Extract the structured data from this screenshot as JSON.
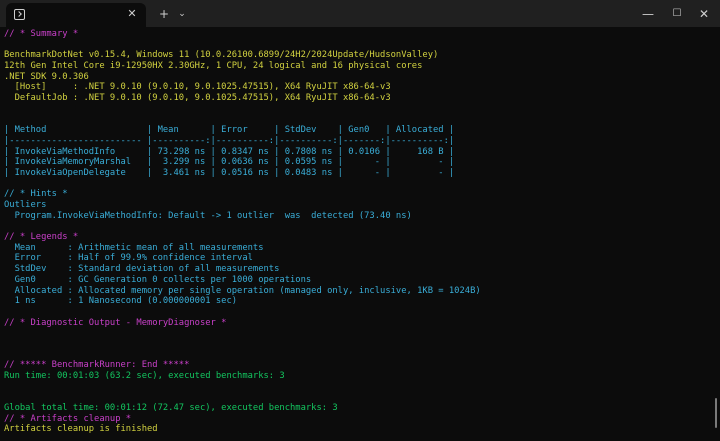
{
  "window": {
    "tab_close": "✕",
    "new_tab": "+",
    "dropdown": "⌄",
    "minimize": "—",
    "maximize": "☐",
    "close": "✕"
  },
  "colors": {
    "background": "#0c0c0c",
    "titlebar": "#202020",
    "magenta": "#c940c9",
    "yellow": "#d2d240",
    "cyan": "#3aaed8",
    "green": "#13c760",
    "white": "#e8e8e8",
    "gray": "#cccccc"
  },
  "terminal": {
    "lines": [
      {
        "text": "// * Summary *",
        "color": "magenta"
      },
      {
        "text": "",
        "color": "gray"
      },
      {
        "text": "BenchmarkDotNet v0.15.4, Windows 11 (10.0.26100.6899/24H2/2024Update/HudsonValley)",
        "color": "yellow"
      },
      {
        "text": "12th Gen Intel Core i9-12950HX 2.30GHz, 1 CPU, 24 logical and 16 physical cores",
        "color": "yellow"
      },
      {
        "text": ".NET SDK 9.0.306",
        "color": "yellow"
      },
      {
        "text": "  [Host]     : .NET 9.0.10 (9.0.10, 9.0.1025.47515), X64 RyuJIT x86-64-v3",
        "color": "yellow"
      },
      {
        "text": "  DefaultJob : .NET 9.0.10 (9.0.10, 9.0.1025.47515), X64 RyuJIT x86-64-v3",
        "color": "yellow"
      },
      {
        "text": "",
        "color": "gray"
      },
      {
        "text": "",
        "color": "gray"
      },
      {
        "text": "| Method                   | Mean      | Error     | StdDev    | Gen0   | Allocated |",
        "color": "cyan"
      },
      {
        "text": "|------------------------- |----------:|----------:|----------:|-------:|----------:|",
        "color": "cyan"
      },
      {
        "text": "| InvokeViaMethodInfo      | 73.298 ns | 0.8347 ns | 0.7808 ns | 0.0106 |     168 B |",
        "color": "cyan"
      },
      {
        "text": "| InvokeViaMemoryMarshal   |  3.299 ns | 0.0636 ns | 0.0595 ns |      - |         - |",
        "color": "cyan"
      },
      {
        "text": "| InvokeViaOpenDelegate    |  3.461 ns | 0.0516 ns | 0.0483 ns |      - |         - |",
        "color": "cyan"
      },
      {
        "text": "",
        "color": "gray"
      },
      {
        "text": "// * Hints *",
        "color": "cyan"
      },
      {
        "text": "Outliers",
        "color": "cyan"
      },
      {
        "text": "  Program.InvokeViaMethodInfo: Default -> 1 outlier  was  detected (73.40 ns)",
        "color": "cyan"
      },
      {
        "text": "",
        "color": "gray"
      },
      {
        "text": "// * Legends *",
        "color": "magenta"
      },
      {
        "text": "  Mean      : Arithmetic mean of all measurements",
        "color": "cyan"
      },
      {
        "text": "  Error     : Half of 99.9% confidence interval",
        "color": "cyan"
      },
      {
        "text": "  StdDev    : Standard deviation of all measurements",
        "color": "cyan"
      },
      {
        "text": "  Gen0      : GC Generation 0 collects per 1000 operations",
        "color": "cyan"
      },
      {
        "text": "  Allocated : Allocated memory per single operation (managed only, inclusive, 1KB = 1024B)",
        "color": "cyan"
      },
      {
        "text": "  1 ns      : 1 Nanosecond (0.000000001 sec)",
        "color": "cyan"
      },
      {
        "text": "",
        "color": "gray"
      },
      {
        "text": "// * Diagnostic Output - MemoryDiagnoser *",
        "color": "magenta"
      },
      {
        "text": "",
        "color": "gray"
      },
      {
        "text": "",
        "color": "gray"
      },
      {
        "text": "",
        "color": "gray"
      },
      {
        "text": "// ***** BenchmarkRunner: End *****",
        "color": "magenta"
      },
      {
        "text": "Run time: 00:01:03 (63.2 sec), executed benchmarks: 3",
        "color": "green"
      },
      {
        "text": "",
        "color": "gray"
      },
      {
        "text": "",
        "color": "gray"
      },
      {
        "text": "Global total time: 00:01:12 (72.47 sec), executed benchmarks: 3",
        "color": "green"
      },
      {
        "text": "// * Artifacts cleanup *",
        "color": "magenta"
      },
      {
        "text": "Artifacts cleanup is finished",
        "color": "yellow"
      }
    ]
  }
}
